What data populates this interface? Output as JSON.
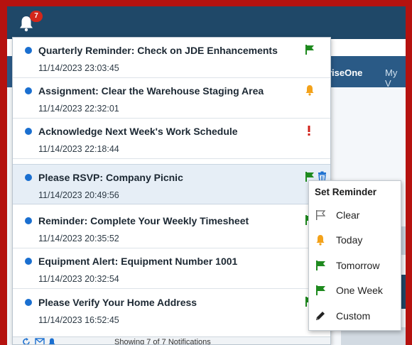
{
  "header": {
    "badge_count": "7"
  },
  "background": {
    "app_title": "riseOne",
    "app_link": "My V"
  },
  "notifications": [
    {
      "title": "Quarterly Reminder: Check on JDE Enhancements",
      "time": "11/14/2023 23:03:45",
      "status_icon": "green-flag"
    },
    {
      "title": "Assignment: Clear the Warehouse Staging Area",
      "time": "11/14/2023 22:32:01",
      "status_icon": "bell"
    },
    {
      "title": "Acknowledge Next Week's Work Schedule",
      "time": "11/14/2023 22:18:44",
      "status_icon": "exclamation"
    },
    {
      "title": "Please RSVP: Company Picnic",
      "time": "11/14/2023 20:49:56",
      "status_icon": "green-flag"
    },
    {
      "title": "Reminder: Complete Your Weekly Timesheet",
      "time": "11/14/2023 20:35:52",
      "status_icon": "green-flag"
    },
    {
      "title": "Equipment Alert: Equipment Number 1001",
      "time": "11/14/2023 20:32:54",
      "status_icon": "none"
    },
    {
      "title": "Please Verify Your Home Address",
      "time": "11/14/2023 16:52:45",
      "status_icon": "green-flag"
    }
  ],
  "footer": {
    "summary": "Showing 7 of 7 Notifications"
  },
  "reminder_menu": {
    "title": "Set Reminder",
    "items": [
      {
        "label": "Clear",
        "icon": "outline-flag"
      },
      {
        "label": "Today",
        "icon": "bell"
      },
      {
        "label": "Tomorrow",
        "icon": "green-flag"
      },
      {
        "label": "One Week",
        "icon": "green-flag"
      },
      {
        "label": "Custom",
        "icon": "pencil"
      }
    ]
  },
  "colors": {
    "border_red": "#b5120f",
    "header_navy": "#1f4868",
    "unread_dot": "#1a6fd0",
    "flag_green": "#1e8a1e",
    "bell_amber": "#f3a21a",
    "alert_red": "#d0201a"
  }
}
